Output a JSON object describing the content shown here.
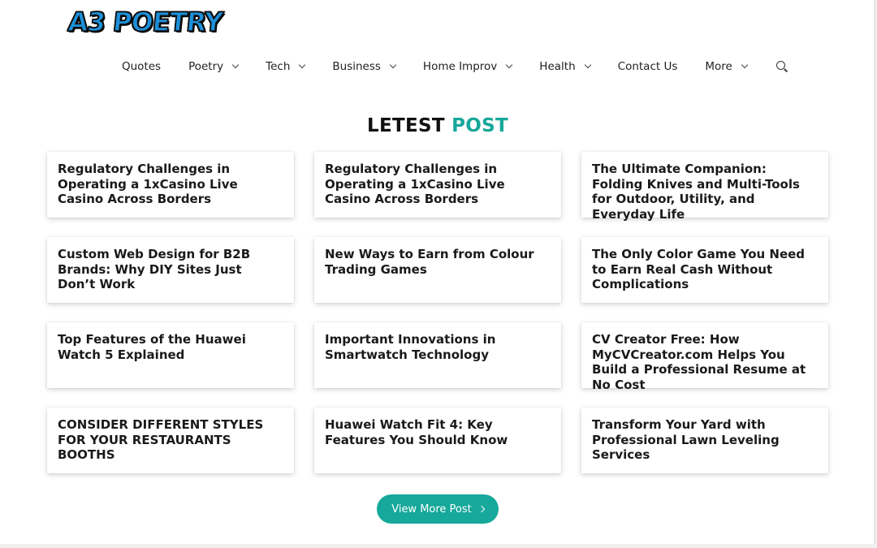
{
  "header": {
    "logo_text": "A3 POETRY"
  },
  "nav": {
    "items": [
      {
        "label": "Quotes",
        "dropdown": false
      },
      {
        "label": "Poetry",
        "dropdown": true
      },
      {
        "label": "Tech",
        "dropdown": true
      },
      {
        "label": "Business",
        "dropdown": true
      },
      {
        "label": "Home Improv",
        "dropdown": true
      },
      {
        "label": "Health",
        "dropdown": true
      },
      {
        "label": "Contact Us",
        "dropdown": false
      },
      {
        "label": "More",
        "dropdown": true
      }
    ],
    "search_icon": "search-icon"
  },
  "section": {
    "title_part1": "LETEST",
    "title_part2": "POST",
    "accent_color": "#16a89a"
  },
  "posts": [
    {
      "title": "Regulatory Challenges in Operating a 1xCasino Live Casino Across Borders"
    },
    {
      "title": "Regulatory Challenges in Operating a 1xCasino Live Casino Across Borders"
    },
    {
      "title": "The Ultimate Companion: Folding Knives and Multi-Tools for Outdoor, Utility, and Everyday Life"
    },
    {
      "title": "Custom Web Design for B2B Brands: Why DIY Sites Just Don’t Work"
    },
    {
      "title": "New Ways to Earn from Colour Trading Games"
    },
    {
      "title": "The Only Color Game You Need to Earn Real Cash Without Complications"
    },
    {
      "title": "Top Features of the Huawei Watch 5 Explained"
    },
    {
      "title": "Important Innovations in Smartwatch Technology"
    },
    {
      "title": "CV Creator Free: How MyCVCreator.com Helps You Build a Professional Resume at No Cost"
    },
    {
      "title": "CONSIDER DIFFERENT STYLES FOR YOUR RESTAURANTS BOOTHS"
    },
    {
      "title": "Huawei Watch Fit 4: Key Features You Should Know"
    },
    {
      "title": "Transform Your Yard with Professional Lawn Leveling Services"
    }
  ],
  "footer_button": {
    "label": "View More Post",
    "icon": "chevron-right-icon"
  }
}
